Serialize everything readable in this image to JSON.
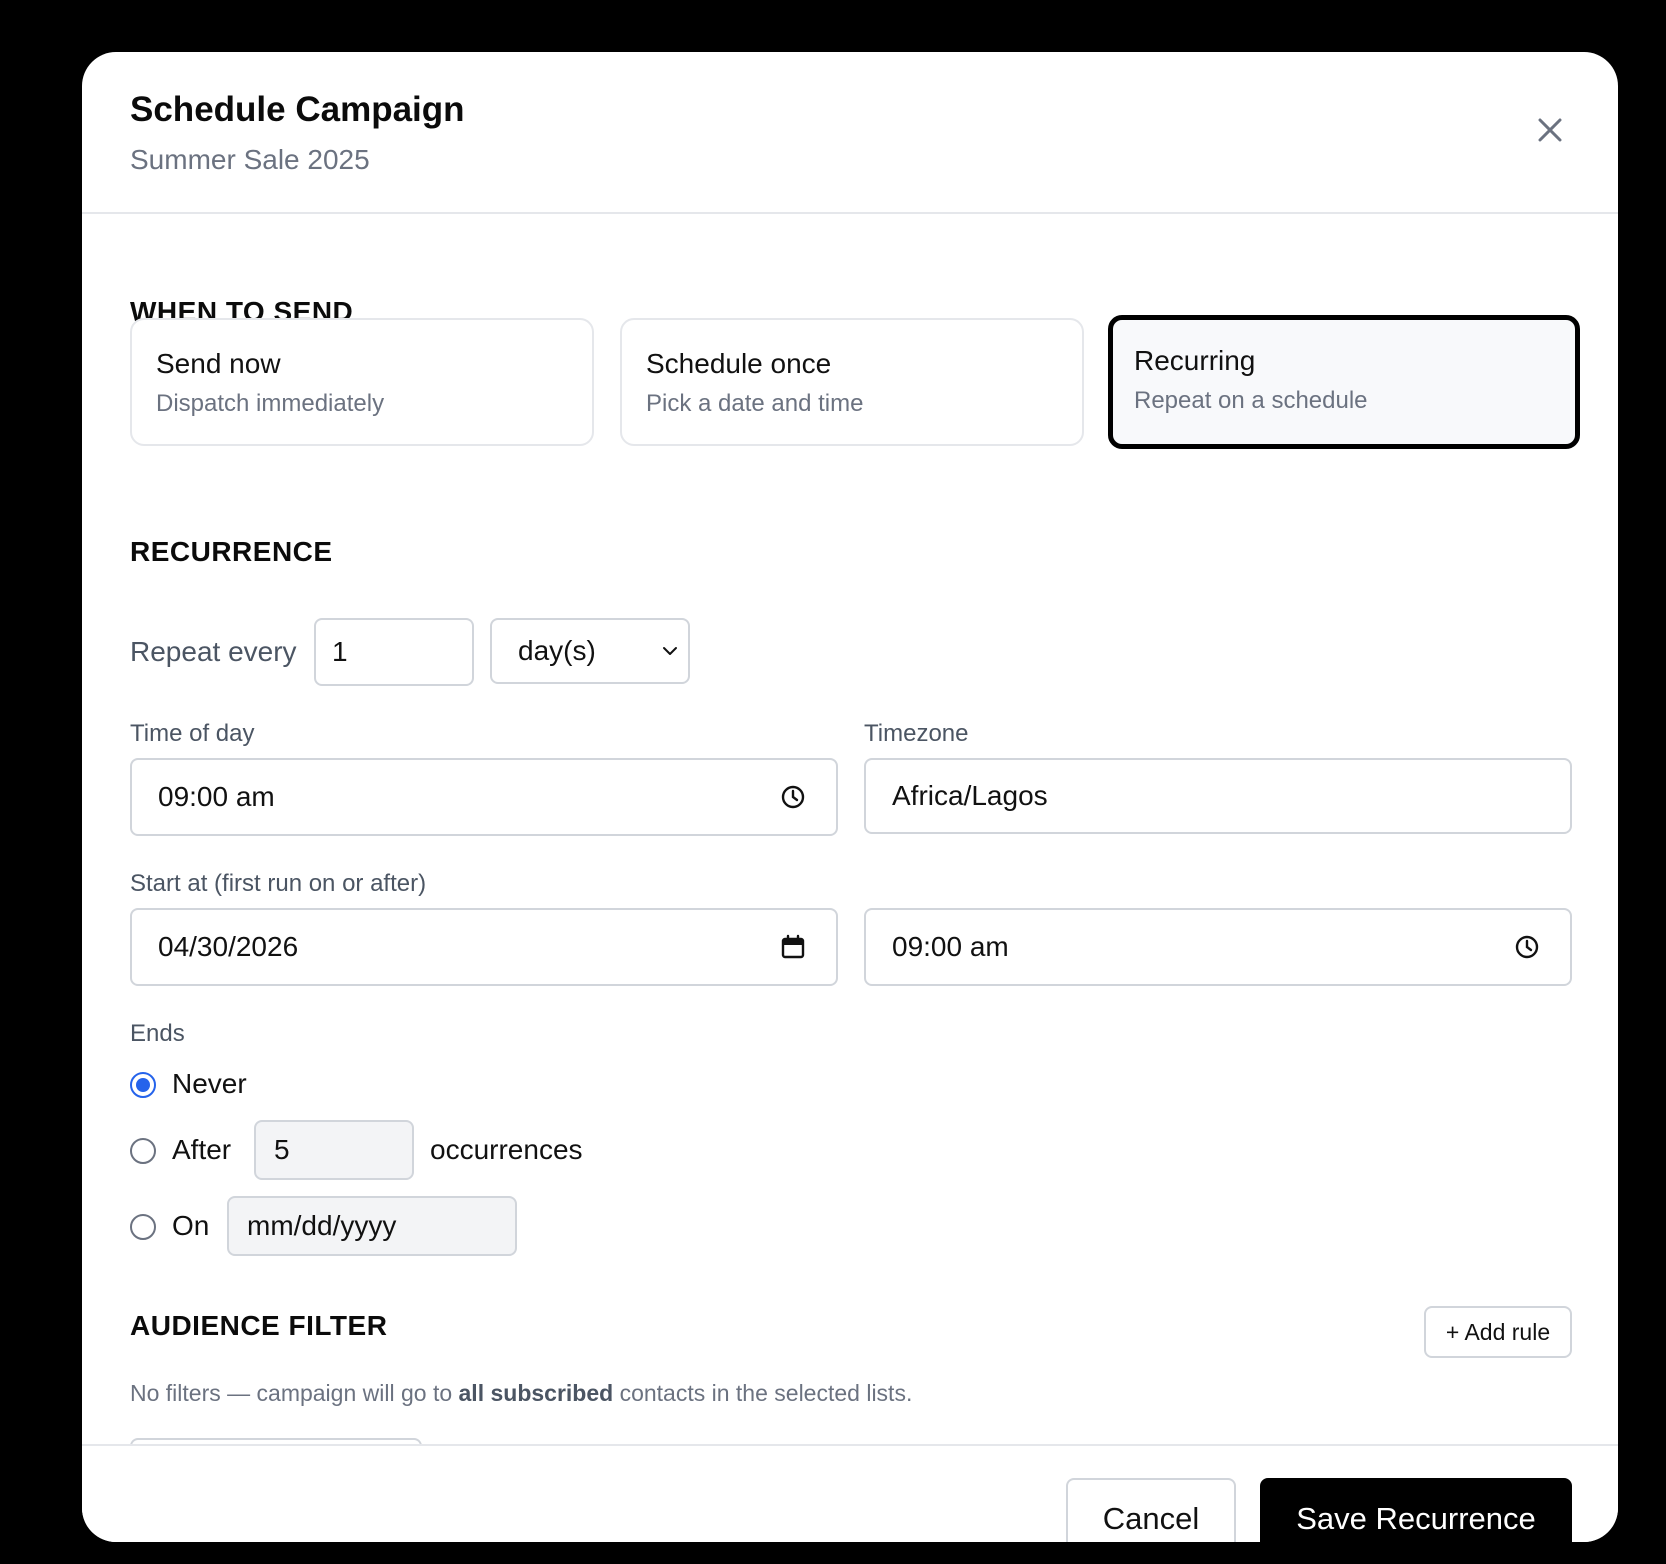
{
  "dialog": {
    "title": "Schedule Campaign",
    "subtitle": "Summer Sale 2025"
  },
  "when_to_send": {
    "heading": "WHEN TO SEND",
    "options": [
      {
        "title": "Send now",
        "description": "Dispatch immediately",
        "selected": false
      },
      {
        "title": "Schedule once",
        "description": "Pick a date and time",
        "selected": false
      },
      {
        "title": "Recurring",
        "description": "Repeat on a schedule",
        "selected": true
      }
    ]
  },
  "recurrence": {
    "heading": "RECURRENCE",
    "repeat_label": "Repeat every",
    "repeat_value": "1",
    "repeat_unit": "day(s)",
    "time_of_day_label": "Time of day",
    "time_of_day_value": "09:00 am",
    "timezone_label": "Timezone",
    "timezone_value": "Africa/Lagos",
    "start_label": "Start at (first run on or after)",
    "start_date": "04/30/2026",
    "start_time": "09:00 am",
    "ends_label": "Ends",
    "ends_options": {
      "never": "Never",
      "after": "After",
      "after_count": "5",
      "after_suffix": "occurrences",
      "on": "On",
      "on_placeholder": "mm/dd/yyyy"
    },
    "ends_selected": "never"
  },
  "audience_filter": {
    "heading": "AUDIENCE FILTER",
    "add_rule": "+ Add rule",
    "hint_prefix": "No filters — campaign will go to ",
    "hint_bold": "all subscribed",
    "hint_suffix": " contacts in the selected lists."
  },
  "footer": {
    "cancel": "Cancel",
    "save": "Save Recurrence"
  },
  "colors": {
    "accent": "#2563eb",
    "primary_button": "#000000",
    "border": "#d1d5db",
    "muted_text": "#6b7280"
  }
}
